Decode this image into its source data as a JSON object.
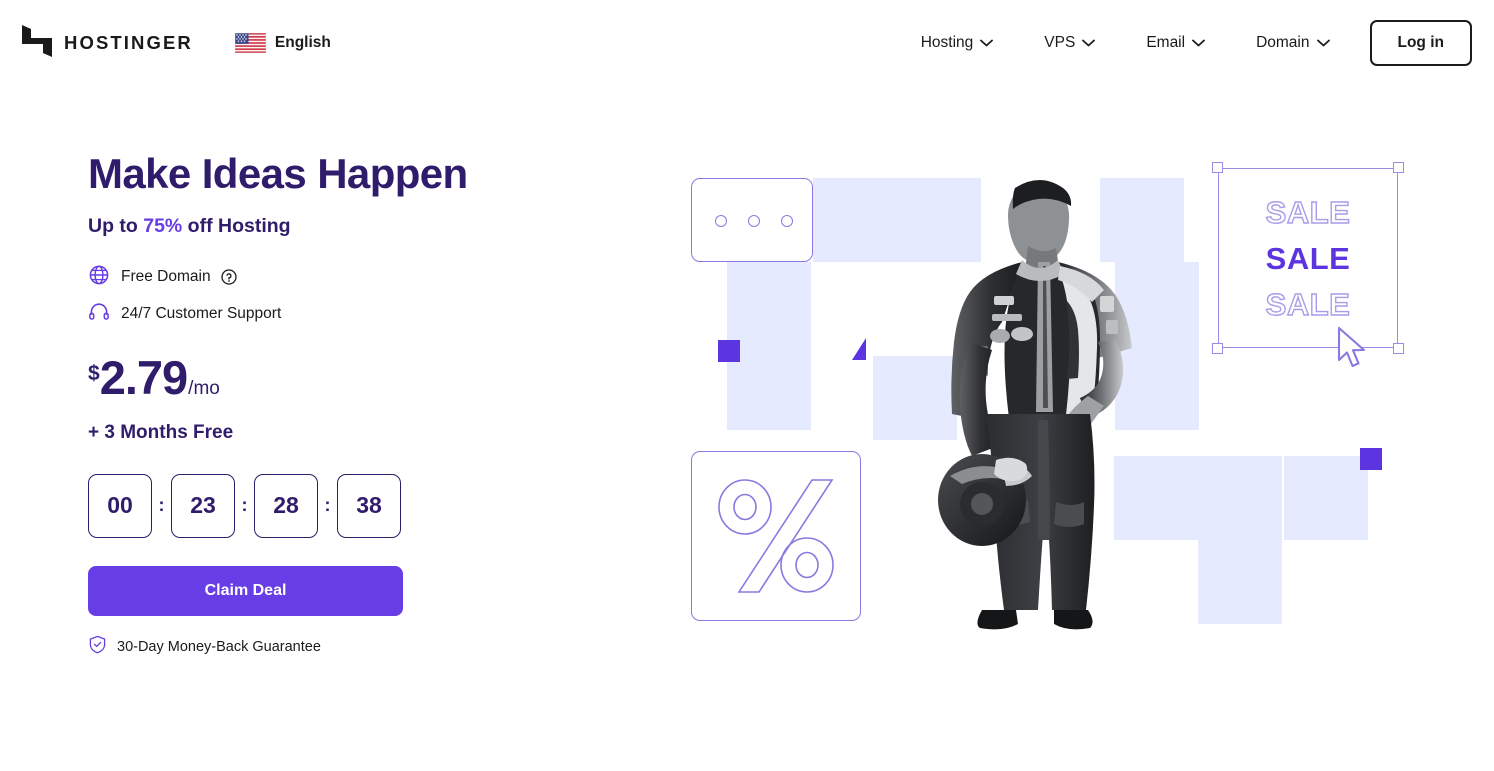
{
  "header": {
    "logo_text": "HOSTINGER",
    "logo_icon": "hostinger-h-logo",
    "language": {
      "label": "English",
      "flag_icon": "us-flag-icon"
    },
    "nav_items": [
      {
        "label": "Hosting",
        "icon": "chevron-down-icon"
      },
      {
        "label": "VPS",
        "icon": "chevron-down-icon"
      },
      {
        "label": "Email",
        "icon": "chevron-down-icon"
      },
      {
        "label": "Domain",
        "icon": "chevron-down-icon"
      }
    ],
    "login_label": "Log in"
  },
  "hero": {
    "headline": "Make Ideas Happen",
    "subhead_prefix": "Up to ",
    "subhead_highlight": "75%",
    "subhead_suffix": " off Hosting",
    "features": [
      {
        "icon": "globe-icon",
        "label": "Free Domain",
        "help_icon": "question-circle-icon"
      },
      {
        "icon": "headset-icon",
        "label": "24/7 Customer Support"
      }
    ],
    "price": {
      "currency": "$",
      "amount": "2.79",
      "period": "/mo"
    },
    "bonus": "+ 3 Months Free",
    "countdown": {
      "separator": ":",
      "cells": [
        "00",
        "23",
        "28",
        "38"
      ]
    },
    "cta_label": "Claim Deal",
    "guarantee": {
      "icon": "shield-check-icon",
      "label": "30-Day Money-Back Guarantee"
    }
  },
  "illustration": {
    "dots_card_icon": "three-dots-card",
    "percent_icon": "percent-symbol-card",
    "sale_lines": [
      "SALE",
      "SALE",
      "SALE"
    ],
    "cursor_icon": "mouse-cursor-icon",
    "person_icon": "racing-driver-photo"
  },
  "colors": {
    "brand_purple": "#673de6",
    "deep_purple": "#2f1c6a",
    "accent_square": "#5c34e0",
    "pale_blue": "#e5eaff",
    "outline_purple": "#8a79e0",
    "text_dark": "#1b1b1b"
  }
}
